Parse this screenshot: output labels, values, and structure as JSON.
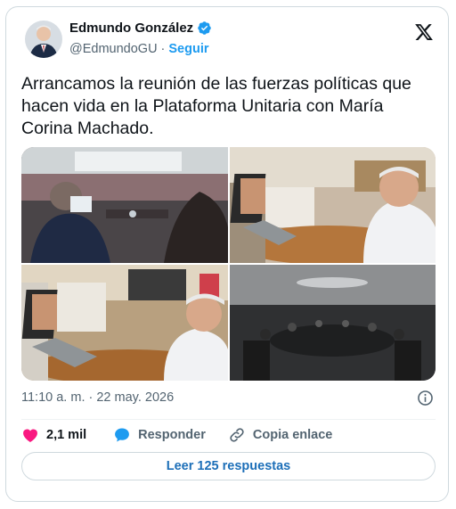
{
  "author": {
    "name": "Edmundo González",
    "handle": "@EdmundoGU",
    "separator": "·",
    "follow_label": "Seguir"
  },
  "tweet": {
    "text": "Arrancamos la reunión de las fuerzas políticas que hacen vida en la Plataforma Unitaria con María Corina Machado."
  },
  "photos": [
    {
      "description_icon": "conference-room-photo"
    },
    {
      "description_icon": "video-call-photo"
    },
    {
      "description_icon": "video-call-photo"
    },
    {
      "description_icon": "meeting-room-wide-photo"
    }
  ],
  "meta": {
    "timestamp": "11:10 a. m. · 22 may. 2026"
  },
  "actions": {
    "likes_count": "2,1 mil",
    "reply_label": "Responder",
    "copy_link_label": "Copia enlace"
  },
  "read_replies_label": "Leer 125 respuestas",
  "colors": {
    "accent": "#1d9bf0",
    "like": "#f91880",
    "text_secondary": "#536471",
    "border": "#cfd9de"
  }
}
